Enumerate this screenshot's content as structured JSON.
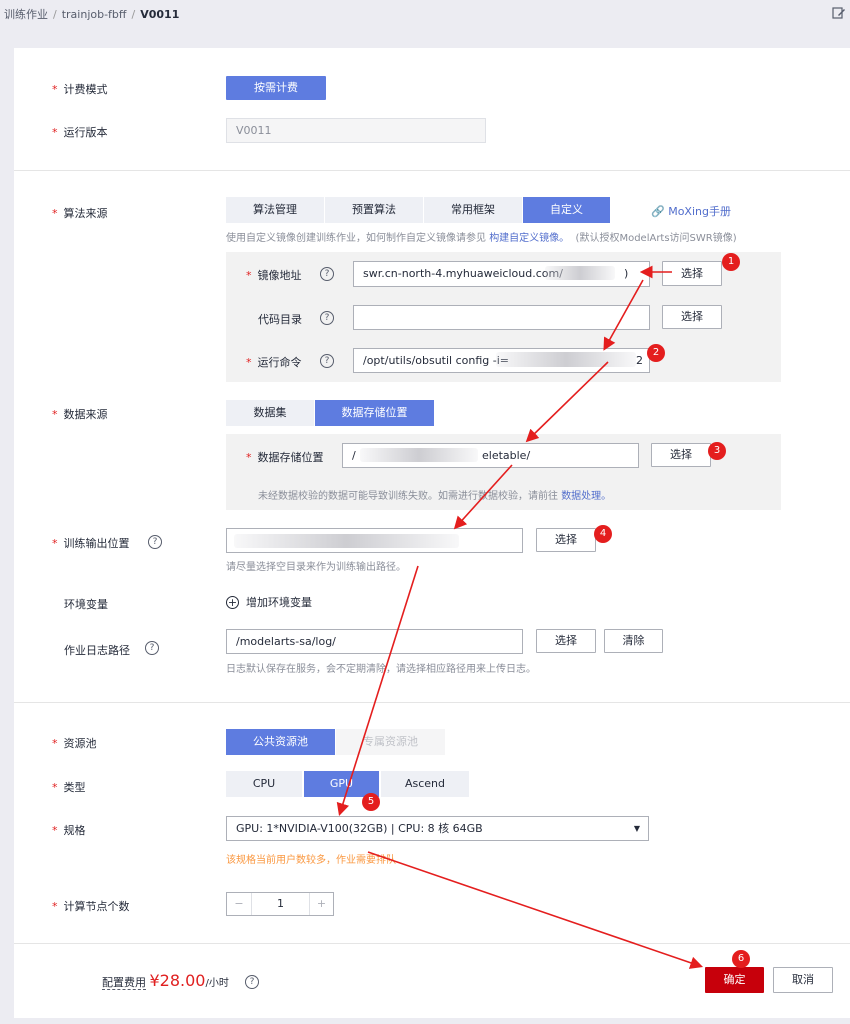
{
  "breadcrumb": {
    "item1": "训练作业",
    "item2": "trainjob-fbff",
    "current": "V0011",
    "sep": "/"
  },
  "form": {
    "billing": {
      "label": "计费模式",
      "option": "按需计费"
    },
    "version": {
      "label": "运行版本",
      "value": "V0011"
    },
    "algorithm": {
      "label": "算法来源",
      "tabs": [
        "算法管理",
        "预置算法",
        "常用框架",
        "自定义"
      ],
      "selected_tab": "自定义",
      "moxing_link": "MoXing手册",
      "hint": "使用自定义镜像创建训练作业，如何制作自定义镜像请参见",
      "hint_link": "构建自定义镜像。",
      "hint_suffix": "(默认授权ModelArts访问SWR镜像)",
      "image_label": "镜像地址",
      "image_value": "swr.cn-north-4.myhuaweicloud.com/",
      "image_tail": ")",
      "code_label": "代码目录",
      "code_value": "",
      "cmd_label": "运行命令",
      "cmd_value": "/opt/utils/obsutil config -i=",
      "cmd_tail": "2",
      "select_btn": "选择"
    },
    "data": {
      "label": "数据来源",
      "tabs": [
        "数据集",
        "数据存储位置"
      ],
      "selected_tab": "数据存储位置",
      "storage_label": "数据存储位置",
      "storage_value_start": "/",
      "storage_value_end": "eletable/",
      "select_btn": "选择",
      "hint": "未经数据校验的数据可能导致训练失败。如需进行数据校验，请前往",
      "hint_link": "数据处理。"
    },
    "output": {
      "label": "训练输出位置",
      "value": "",
      "select_btn": "选择",
      "hint": "请尽量选择空目录来作为训练输出路径。"
    },
    "env": {
      "label": "环境变量",
      "add": "增加环境变量"
    },
    "log": {
      "label": "作业日志路径",
      "value": "/modelarts-sa/log/",
      "select_btn": "选择",
      "clear_btn": "清除",
      "hint": "日志默认保存在服务，会不定期清除，请选择相应路径用来上传日志。"
    },
    "pool": {
      "label": "资源池",
      "options": [
        "公共资源池",
        "专属资源池"
      ],
      "selected": "公共资源池"
    },
    "type": {
      "label": "类型",
      "options": [
        "CPU",
        "GPU",
        "Ascend"
      ],
      "selected": "GPU"
    },
    "spec": {
      "label": "规格",
      "value": "GPU: 1*NVIDIA-V100(32GB) | CPU: 8 核 64GB",
      "warning": "该规格当前用户数较多，作业需要排队"
    },
    "nodes": {
      "label": "计算节点个数",
      "value": "1",
      "minus": "−",
      "plus": "+"
    }
  },
  "footer": {
    "cost_label": "配置费用",
    "price": "¥28.00",
    "unit": "/小时",
    "confirm": "确定",
    "cancel": "取消"
  },
  "annotations": [
    "1",
    "2",
    "3",
    "4",
    "5",
    "6"
  ],
  "colors": {
    "primary": "#5e7ce0",
    "confirm": "#c7000b",
    "required": "#e02020",
    "annotation": "#e41e1e",
    "warning": "#fa9841",
    "link": "#526ecc"
  },
  "icons": {
    "edit": "edit-icon",
    "help": "help-icon",
    "add": "plus-circle-icon",
    "dropdown": "caret-down-icon",
    "link": "link-icon"
  }
}
